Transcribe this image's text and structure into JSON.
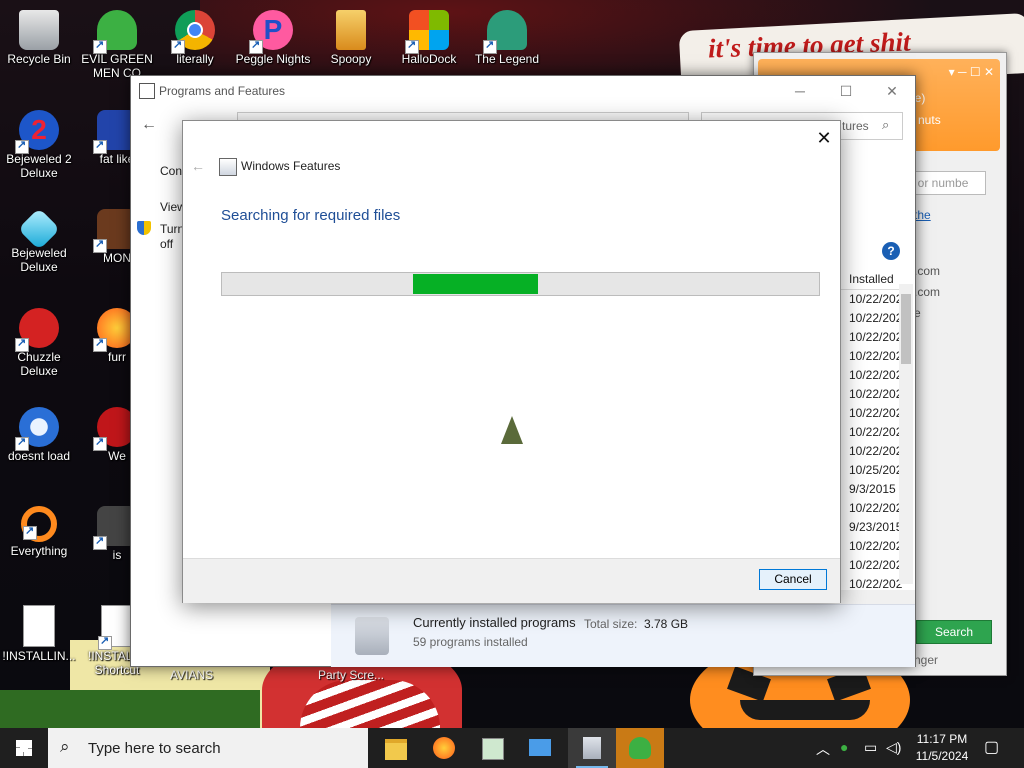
{
  "desktop": {
    "icons": [
      {
        "label": "Recycle Bin",
        "icon": "recycle-bin-icon"
      },
      {
        "label": "EVIL GREEN MEN CO",
        "icon": "green-men-icon"
      },
      {
        "label": "literally",
        "icon": "chrome-icon"
      },
      {
        "label": "Peggle Nights",
        "icon": "peggle-icon"
      },
      {
        "label": "Spoopy",
        "icon": "spoopy-icon"
      },
      {
        "label": "HalloDock",
        "icon": "windows-logo-icon"
      },
      {
        "label": "The Legend",
        "icon": "legend-icon"
      },
      {
        "label": "Bejeweled 2 Deluxe",
        "icon": "bejeweled2-icon"
      },
      {
        "label": "fat like",
        "icon": "app-icon"
      },
      {
        "label": "Bejeweled Deluxe",
        "icon": "bejeweled-icon"
      },
      {
        "label": "MON",
        "icon": "app-icon"
      },
      {
        "label": "Chuzzle Deluxe",
        "icon": "chuzzle-icon"
      },
      {
        "label": "furr",
        "icon": "firefox-icon"
      },
      {
        "label": "doesnt load",
        "icon": "thunderbird-icon"
      },
      {
        "label": "We",
        "icon": "app-icon"
      },
      {
        "label": "Everything",
        "icon": "everything-search-icon"
      },
      {
        "label": "is",
        "icon": "app-icon"
      },
      {
        "label": "!INSTALLIN...",
        "icon": "text-file-icon"
      },
      {
        "label": "!INSTALL - Shortcut",
        "icon": "text-file-icon"
      },
      {
        "label": "AVIANS",
        "icon": "app-icon"
      },
      {
        "label": "Party Scre...",
        "icon": "app-icon"
      }
    ],
    "wallpaper_banner": "it's time to get shit"
  },
  "messenger_window": {
    "lines": [
      "ne)",
      "e nuts"
    ],
    "search_placeholder": "ct or numbe",
    "link_text": "the",
    "contacts": [
      ".com",
      ".com",
      "e"
    ],
    "search_button": "Search",
    "footer_text": "nger"
  },
  "programs_window": {
    "title": "Programs and Features",
    "search_placeholder": "tures",
    "left_links": [
      "Cont",
      "View",
      "Turn",
      "off"
    ],
    "column_header": "Installed",
    "dates": [
      "10/22/202",
      "10/22/202",
      "10/22/202",
      "10/22/202",
      "10/22/202",
      "10/22/202",
      "10/22/202",
      "10/22/202",
      "10/22/202",
      "10/25/202",
      "9/3/2015",
      "10/22/202",
      "9/23/2015",
      "10/22/202",
      "10/22/202",
      "10/22/202"
    ],
    "status": {
      "title": "Currently installed programs",
      "total_size_label": "Total size:",
      "total_size_value": "3.78 GB",
      "count_text": "59 programs installed"
    }
  },
  "windows_features": {
    "title": "Windows Features",
    "heading": "Searching for required files",
    "progress_start": 0.32,
    "progress_end": 0.53,
    "cancel_label": "Cancel"
  },
  "taskbar": {
    "search_placeholder": "Type here to search",
    "time": "11:17 PM",
    "date": "11/5/2024",
    "apps": [
      "file-explorer-icon",
      "firefox-icon",
      "notepad-icon",
      "control-panel-icon",
      "installer-icon",
      "messenger-icon"
    ]
  },
  "colors": {
    "progress": "#06b025",
    "heading": "#1f4e96",
    "accent": "#0078d7"
  }
}
